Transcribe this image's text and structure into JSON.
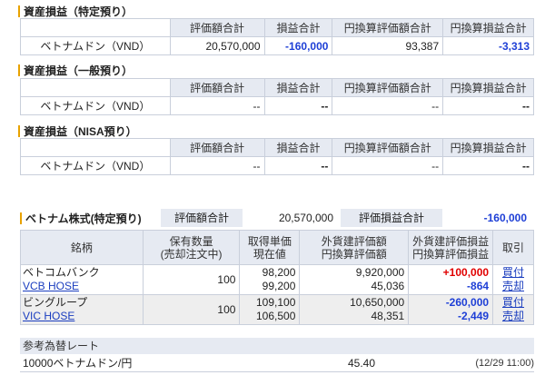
{
  "specific_account": {
    "title": "資産損益（特定預り）",
    "headers": [
      "評価額合計",
      "損益合計",
      "円換算評価額合計",
      "円換算損益合計"
    ],
    "row": {
      "label": "ベトナムドン（VND）",
      "valuation": "20,570,000",
      "pnl": "-160,000",
      "jpy_valuation": "93,387",
      "jpy_pnl": "-3,313"
    }
  },
  "general_account": {
    "title": "資産損益（一般預り）",
    "headers": [
      "評価額合計",
      "損益合計",
      "円換算評価額合計",
      "円換算損益合計"
    ],
    "row": {
      "label": "ベトナムドン（VND）",
      "valuation": "--",
      "pnl": "--",
      "jpy_valuation": "--",
      "jpy_pnl": "--"
    }
  },
  "nisa_account": {
    "title": "資産損益（NISA預り）",
    "headers": [
      "評価額合計",
      "損益合計",
      "円換算評価額合計",
      "円換算損益合計"
    ],
    "row": {
      "label": "ベトナムドン（VND）",
      "valuation": "--",
      "pnl": "--",
      "jpy_valuation": "--",
      "jpy_pnl": "--"
    }
  },
  "vietnam_stocks": {
    "title": "ベトナム株式(特定預り)",
    "valuation_label": "評価額合計",
    "valuation_value": "20,570,000",
    "pnl_label": "評価損益合計",
    "pnl_value": "-160,000",
    "headers": {
      "stock": "銘柄",
      "qty_1": "保有数量",
      "qty_2": "(売却注文中)",
      "price_1": "取得単価",
      "price_2": "現在値",
      "fx_val_1": "外貨建評価額",
      "fx_val_2": "円換算評価額",
      "fx_pnl_1": "外貨建評価損益",
      "fx_pnl_2": "円換算評価損益",
      "trade": "取引"
    },
    "rows": [
      {
        "name": "ベトコムバンク",
        "code": "VCB HOSE",
        "qty": "100",
        "cost": "98,200",
        "price": "99,200",
        "fx_value": "9,920,000",
        "jpy_value": "45,036",
        "fx_pnl": "+100,000",
        "jpy_pnl": "-864",
        "buy": "買付",
        "sell": "売却"
      },
      {
        "name": "ビングループ",
        "code": "VIC HOSE",
        "qty": "100",
        "cost": "109,100",
        "price": "106,500",
        "fx_value": "10,650,000",
        "jpy_value": "48,351",
        "fx_pnl": "-260,000",
        "jpy_pnl": "-2,449",
        "buy": "買付",
        "sell": "売却"
      }
    ]
  },
  "reference_rate": {
    "title": "参考為替レート",
    "pair": "10000ベトナムドン/円",
    "rate": "45.40",
    "time": "(12/29 11:00)"
  },
  "colors": {
    "header_bg": "#e6eaf2",
    "negative": "#1e3fd6",
    "positive": "#e00000",
    "accent_bar": "#e8a200",
    "link": "#1a3dbf"
  }
}
